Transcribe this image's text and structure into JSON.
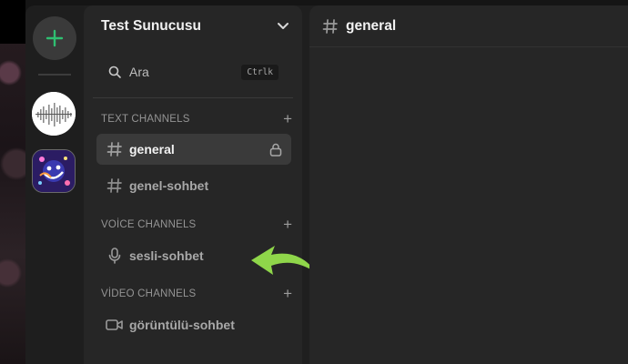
{
  "server": {
    "name": "Test Sunucusu"
  },
  "search": {
    "placeholder": "Ara",
    "shortcut": "Ctrlk"
  },
  "categories": [
    {
      "label": "TEXT CHANNELS"
    },
    {
      "label": "VOİCE CHANNELS"
    },
    {
      "label": "VİDEO CHANNELS"
    }
  ],
  "channels": [
    {
      "label": "general",
      "type": "text",
      "active": true,
      "locked": true
    },
    {
      "label": "genel-sohbet",
      "type": "text"
    },
    {
      "label": "sesli-sohbet",
      "type": "voice"
    },
    {
      "label": "görüntülü-sohbet",
      "type": "video"
    }
  ],
  "main": {
    "title": "general"
  },
  "icons": {
    "add_server": "plus-icon",
    "chevron": "chevron-down-icon",
    "search": "search-icon",
    "text_channel": "hash-icon",
    "lock": "lock-icon",
    "voice_channel": "microphone-icon",
    "video_channel": "camera-icon",
    "annotation": "arrow-icon"
  },
  "colors": {
    "accent": "#2fbf71",
    "arrow": "#8fd64a"
  }
}
